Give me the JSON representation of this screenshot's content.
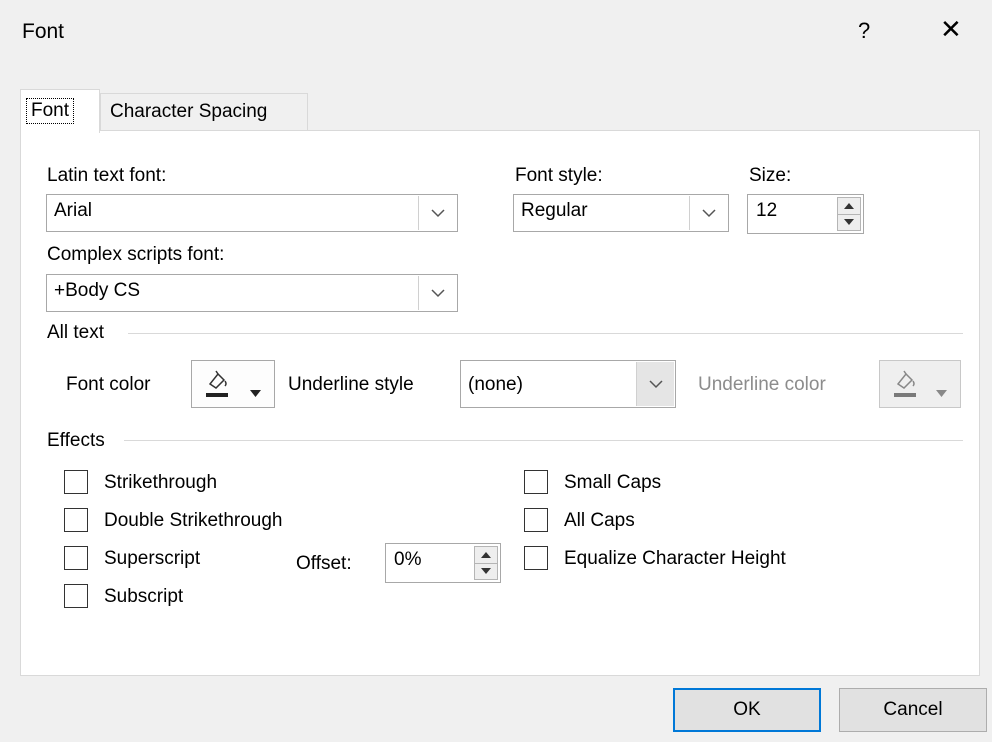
{
  "dialog": {
    "title": "Font",
    "help": "?",
    "close": "✕"
  },
  "tabs": [
    {
      "label": "Font",
      "active": true
    },
    {
      "label": "Character Spacing",
      "active": false
    }
  ],
  "latin_font": {
    "label": "Latin text font:",
    "value": "Arial"
  },
  "font_style": {
    "label": "Font style:",
    "value": "Regular"
  },
  "size": {
    "label": "Size:",
    "value": "12"
  },
  "complex_font": {
    "label": "Complex scripts font:",
    "value": "+Body CS"
  },
  "all_text": {
    "section": "All text",
    "font_color_label": "Font color",
    "underline_style_label": "Underline style",
    "underline_style_value": "(none)",
    "underline_color_label": "Underline color"
  },
  "effects": {
    "section": "Effects",
    "strikethrough": {
      "label": "Strikethrough",
      "checked": false
    },
    "double_strikethrough": {
      "label": "Double Strikethrough",
      "checked": false
    },
    "superscript": {
      "label": "Superscript",
      "checked": false
    },
    "subscript": {
      "label": "Subscript",
      "checked": false
    },
    "offset_label": "Offset:",
    "offset_value": "0%",
    "small_caps": {
      "label": "Small Caps",
      "checked": false
    },
    "all_caps": {
      "label": "All Caps",
      "checked": false
    },
    "equalize": {
      "label": "Equalize Character Height",
      "checked": false
    }
  },
  "buttons": {
    "ok": "OK",
    "cancel": "Cancel"
  },
  "colors": {
    "font_color": "#222222",
    "underline_color": "#7a7a7a",
    "ok_border": "#0078d7"
  },
  "icons": {
    "help": "question-mark-icon",
    "close": "close-x-icon",
    "dropdown": "chevron-down-icon",
    "spin": "spin-up-down-icon",
    "paint": "paint-bucket-icon"
  }
}
